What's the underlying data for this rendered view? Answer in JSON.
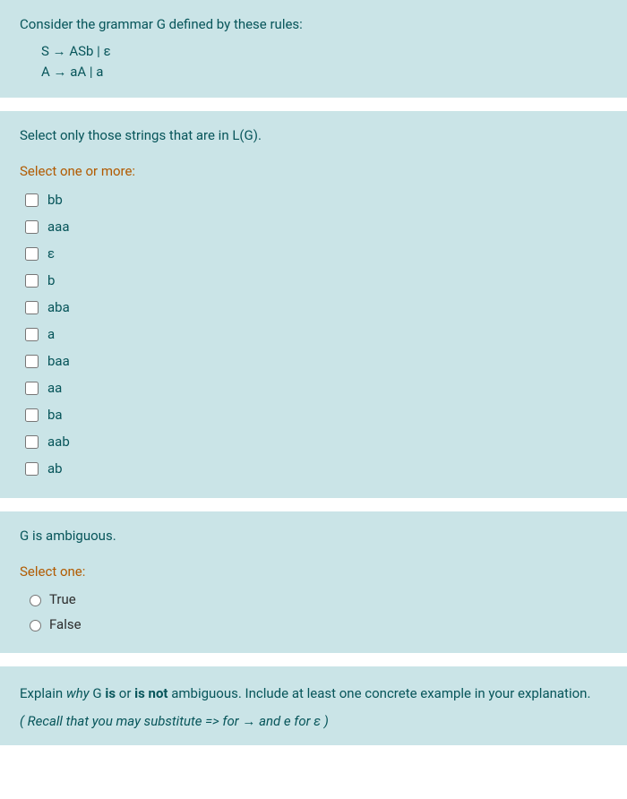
{
  "q1": {
    "intro": "Consider the grammar G defined by these rules:",
    "rule1": "S → ASb | ε",
    "rule2": "A → aA | a"
  },
  "q2": {
    "instruction": "Select only those strings that are in L(G).",
    "select_label": "Select one or more:",
    "options": [
      "bb",
      "aaa",
      "ε",
      "b",
      "aba",
      "a",
      "baa",
      "aa",
      "ba",
      "aab",
      "ab"
    ]
  },
  "q3": {
    "statement": "G is ambiguous.",
    "select_label": "Select one:",
    "opt_true": "True",
    "opt_false": "False"
  },
  "q4": {
    "prefix": "Explain ",
    "why": "why",
    "mid1": " G ",
    "is": "is",
    "mid2": " or ",
    "isnot": "is not",
    "suffix": " ambiguous.  Include at least one concrete example in your explanation.",
    "recall": "( Recall that you may substitute   =>  for  →   and   e   for  ε )"
  }
}
